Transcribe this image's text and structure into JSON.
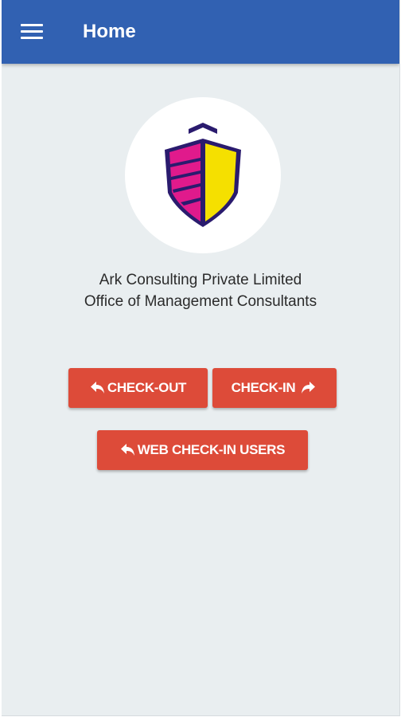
{
  "app_bar": {
    "title": "Home",
    "menu_icon": "hamburger-menu-icon",
    "background_color": "#3161b2"
  },
  "company": {
    "logo": "shield-logo",
    "name": "Ark Consulting Private Limited",
    "subtitle": "Office of Management Consultants"
  },
  "actions": {
    "check_out_label": "CHECK-OUT",
    "check_out_icon": "reply-arrow-icon",
    "check_in_label": "CHECK-IN",
    "check_in_icon": "share-arrow-icon",
    "web_check_in_label": "WEB CHECK-IN USERS",
    "web_check_in_icon": "reply-arrow-icon",
    "button_color": "#dd4b39"
  }
}
